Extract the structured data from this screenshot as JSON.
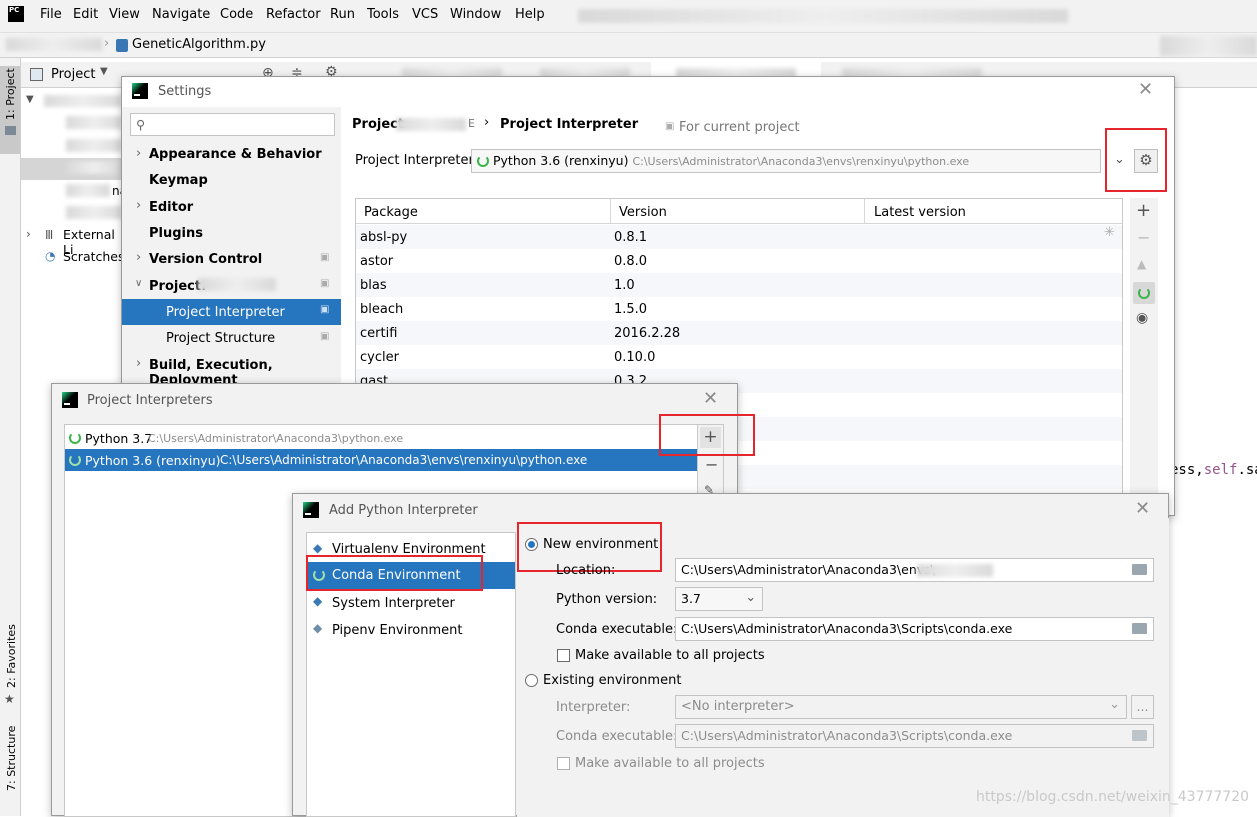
{
  "menubar": {
    "items": [
      "File",
      "Edit",
      "View",
      "Navigate",
      "Code",
      "Refactor",
      "Run",
      "Tools",
      "VCS",
      "Window",
      "Help"
    ]
  },
  "navbar": {
    "file": "GeneticAlgorithm.py"
  },
  "leftstrip": {
    "project": "1: Project",
    "favorites": "2: Favorites",
    "structure": "7: Structure"
  },
  "project_panel": {
    "title": "Project",
    "external_libraries": "External Li",
    "scratches": "Scratches",
    "na": "na"
  },
  "editor": {
    "code_fragment_1": "ess,",
    "code_fragment_self": "self",
    "code_fragment_2": ".sav",
    "watermark": "https://blog.csdn.net/weixin_43777720"
  },
  "settings": {
    "title": "Settings",
    "search_placeholder": "",
    "nav": {
      "appearance": "Appearance & Behavior",
      "keymap": "Keymap",
      "editor": "Editor",
      "plugins": "Plugins",
      "version_control": "Version Control",
      "project": "Project:",
      "project_interpreter": "Project Interpreter",
      "project_structure": "Project Structure",
      "build": "Build, Execution, Deployment"
    },
    "breadcrumb_project": "Project",
    "breadcrumb_suffix": "E",
    "breadcrumb_sep": "›",
    "breadcrumb_page": "Project Interpreter",
    "for_current_project": "For current project",
    "interpreter_label": "Project Interpreter:",
    "interpreter_name": "Python 3.6 (renxinyu)",
    "interpreter_path": "C:\\Users\\Administrator\\Anaconda3\\envs\\renxinyu\\python.exe",
    "columns": [
      "Package",
      "Version",
      "Latest version"
    ],
    "packages": [
      {
        "name": "absl-py",
        "version": "0.8.1"
      },
      {
        "name": "astor",
        "version": "0.8.0"
      },
      {
        "name": "blas",
        "version": "1.0"
      },
      {
        "name": "bleach",
        "version": "1.5.0"
      },
      {
        "name": "certifi",
        "version": "2016.2.28"
      },
      {
        "name": "cycler",
        "version": "0.10.0"
      },
      {
        "name": "gast",
        "version": "0.3.2"
      }
    ]
  },
  "interpreters_dialog": {
    "title": "Project Interpreters",
    "items": [
      {
        "name": "Python 3.7",
        "path": "C:\\Users\\Administrator\\Anaconda3\\python.exe"
      },
      {
        "name": "Python 3.6 (renxinyu)",
        "path": "C:\\Users\\Administrator\\Anaconda3\\envs\\renxinyu\\python.exe"
      }
    ],
    "add": "+",
    "remove": "−"
  },
  "add_dialog": {
    "title": "Add Python Interpreter",
    "types": [
      "Virtualenv Environment",
      "Conda Environment",
      "System Interpreter",
      "Pipenv Environment"
    ],
    "new_env": "New environment",
    "location_label": "Location:",
    "location_value": "C:\\Users\\Administrator\\Anaconda3\\envs\\",
    "python_version_label": "Python version:",
    "python_version_value": "3.7",
    "conda_exec_label": "Conda executable:",
    "conda_exec_value": "C:\\Users\\Administrator\\Anaconda3\\Scripts\\conda.exe",
    "make_available": "Make available to all projects",
    "existing_env": "Existing environment",
    "interpreter_label": "Interpreter:",
    "interpreter_value": "<No interpreter>",
    "browse": "...",
    "existing_conda_label": "Conda executable:",
    "existing_conda_value": "C:\\Users\\Administrator\\Anaconda3\\Scripts\\conda.exe",
    "existing_make_available": "Make available to all projects"
  },
  "colors": {
    "selection": "#2675bf",
    "highlight_box": "#e5262c",
    "conda_green": "#3bb54a"
  }
}
